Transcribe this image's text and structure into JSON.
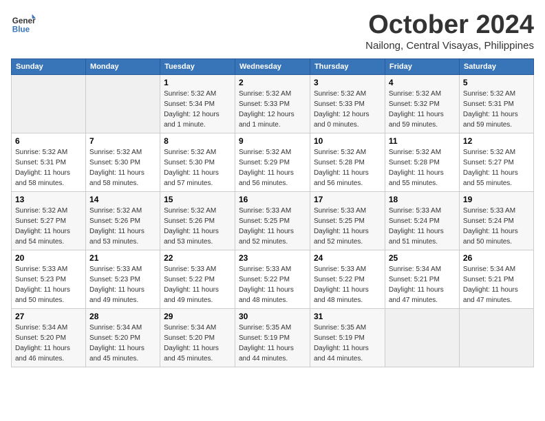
{
  "header": {
    "logo_line1": "General",
    "logo_line2": "Blue",
    "month_title": "October 2024",
    "location": "Nailong, Central Visayas, Philippines"
  },
  "days_of_week": [
    "Sunday",
    "Monday",
    "Tuesday",
    "Wednesday",
    "Thursday",
    "Friday",
    "Saturday"
  ],
  "weeks": [
    [
      {
        "day": "",
        "info": ""
      },
      {
        "day": "",
        "info": ""
      },
      {
        "day": "1",
        "info": "Sunrise: 5:32 AM\nSunset: 5:34 PM\nDaylight: 12 hours\nand 1 minute."
      },
      {
        "day": "2",
        "info": "Sunrise: 5:32 AM\nSunset: 5:33 PM\nDaylight: 12 hours\nand 1 minute."
      },
      {
        "day": "3",
        "info": "Sunrise: 5:32 AM\nSunset: 5:33 PM\nDaylight: 12 hours\nand 0 minutes."
      },
      {
        "day": "4",
        "info": "Sunrise: 5:32 AM\nSunset: 5:32 PM\nDaylight: 11 hours\nand 59 minutes."
      },
      {
        "day": "5",
        "info": "Sunrise: 5:32 AM\nSunset: 5:31 PM\nDaylight: 11 hours\nand 59 minutes."
      }
    ],
    [
      {
        "day": "6",
        "info": "Sunrise: 5:32 AM\nSunset: 5:31 PM\nDaylight: 11 hours\nand 58 minutes."
      },
      {
        "day": "7",
        "info": "Sunrise: 5:32 AM\nSunset: 5:30 PM\nDaylight: 11 hours\nand 58 minutes."
      },
      {
        "day": "8",
        "info": "Sunrise: 5:32 AM\nSunset: 5:30 PM\nDaylight: 11 hours\nand 57 minutes."
      },
      {
        "day": "9",
        "info": "Sunrise: 5:32 AM\nSunset: 5:29 PM\nDaylight: 11 hours\nand 56 minutes."
      },
      {
        "day": "10",
        "info": "Sunrise: 5:32 AM\nSunset: 5:28 PM\nDaylight: 11 hours\nand 56 minutes."
      },
      {
        "day": "11",
        "info": "Sunrise: 5:32 AM\nSunset: 5:28 PM\nDaylight: 11 hours\nand 55 minutes."
      },
      {
        "day": "12",
        "info": "Sunrise: 5:32 AM\nSunset: 5:27 PM\nDaylight: 11 hours\nand 55 minutes."
      }
    ],
    [
      {
        "day": "13",
        "info": "Sunrise: 5:32 AM\nSunset: 5:27 PM\nDaylight: 11 hours\nand 54 minutes."
      },
      {
        "day": "14",
        "info": "Sunrise: 5:32 AM\nSunset: 5:26 PM\nDaylight: 11 hours\nand 53 minutes."
      },
      {
        "day": "15",
        "info": "Sunrise: 5:32 AM\nSunset: 5:26 PM\nDaylight: 11 hours\nand 53 minutes."
      },
      {
        "day": "16",
        "info": "Sunrise: 5:33 AM\nSunset: 5:25 PM\nDaylight: 11 hours\nand 52 minutes."
      },
      {
        "day": "17",
        "info": "Sunrise: 5:33 AM\nSunset: 5:25 PM\nDaylight: 11 hours\nand 52 minutes."
      },
      {
        "day": "18",
        "info": "Sunrise: 5:33 AM\nSunset: 5:24 PM\nDaylight: 11 hours\nand 51 minutes."
      },
      {
        "day": "19",
        "info": "Sunrise: 5:33 AM\nSunset: 5:24 PM\nDaylight: 11 hours\nand 50 minutes."
      }
    ],
    [
      {
        "day": "20",
        "info": "Sunrise: 5:33 AM\nSunset: 5:23 PM\nDaylight: 11 hours\nand 50 minutes."
      },
      {
        "day": "21",
        "info": "Sunrise: 5:33 AM\nSunset: 5:23 PM\nDaylight: 11 hours\nand 49 minutes."
      },
      {
        "day": "22",
        "info": "Sunrise: 5:33 AM\nSunset: 5:22 PM\nDaylight: 11 hours\nand 49 minutes."
      },
      {
        "day": "23",
        "info": "Sunrise: 5:33 AM\nSunset: 5:22 PM\nDaylight: 11 hours\nand 48 minutes."
      },
      {
        "day": "24",
        "info": "Sunrise: 5:33 AM\nSunset: 5:22 PM\nDaylight: 11 hours\nand 48 minutes."
      },
      {
        "day": "25",
        "info": "Sunrise: 5:34 AM\nSunset: 5:21 PM\nDaylight: 11 hours\nand 47 minutes."
      },
      {
        "day": "26",
        "info": "Sunrise: 5:34 AM\nSunset: 5:21 PM\nDaylight: 11 hours\nand 47 minutes."
      }
    ],
    [
      {
        "day": "27",
        "info": "Sunrise: 5:34 AM\nSunset: 5:20 PM\nDaylight: 11 hours\nand 46 minutes."
      },
      {
        "day": "28",
        "info": "Sunrise: 5:34 AM\nSunset: 5:20 PM\nDaylight: 11 hours\nand 45 minutes."
      },
      {
        "day": "29",
        "info": "Sunrise: 5:34 AM\nSunset: 5:20 PM\nDaylight: 11 hours\nand 45 minutes."
      },
      {
        "day": "30",
        "info": "Sunrise: 5:35 AM\nSunset: 5:19 PM\nDaylight: 11 hours\nand 44 minutes."
      },
      {
        "day": "31",
        "info": "Sunrise: 5:35 AM\nSunset: 5:19 PM\nDaylight: 11 hours\nand 44 minutes."
      },
      {
        "day": "",
        "info": ""
      },
      {
        "day": "",
        "info": ""
      }
    ]
  ]
}
